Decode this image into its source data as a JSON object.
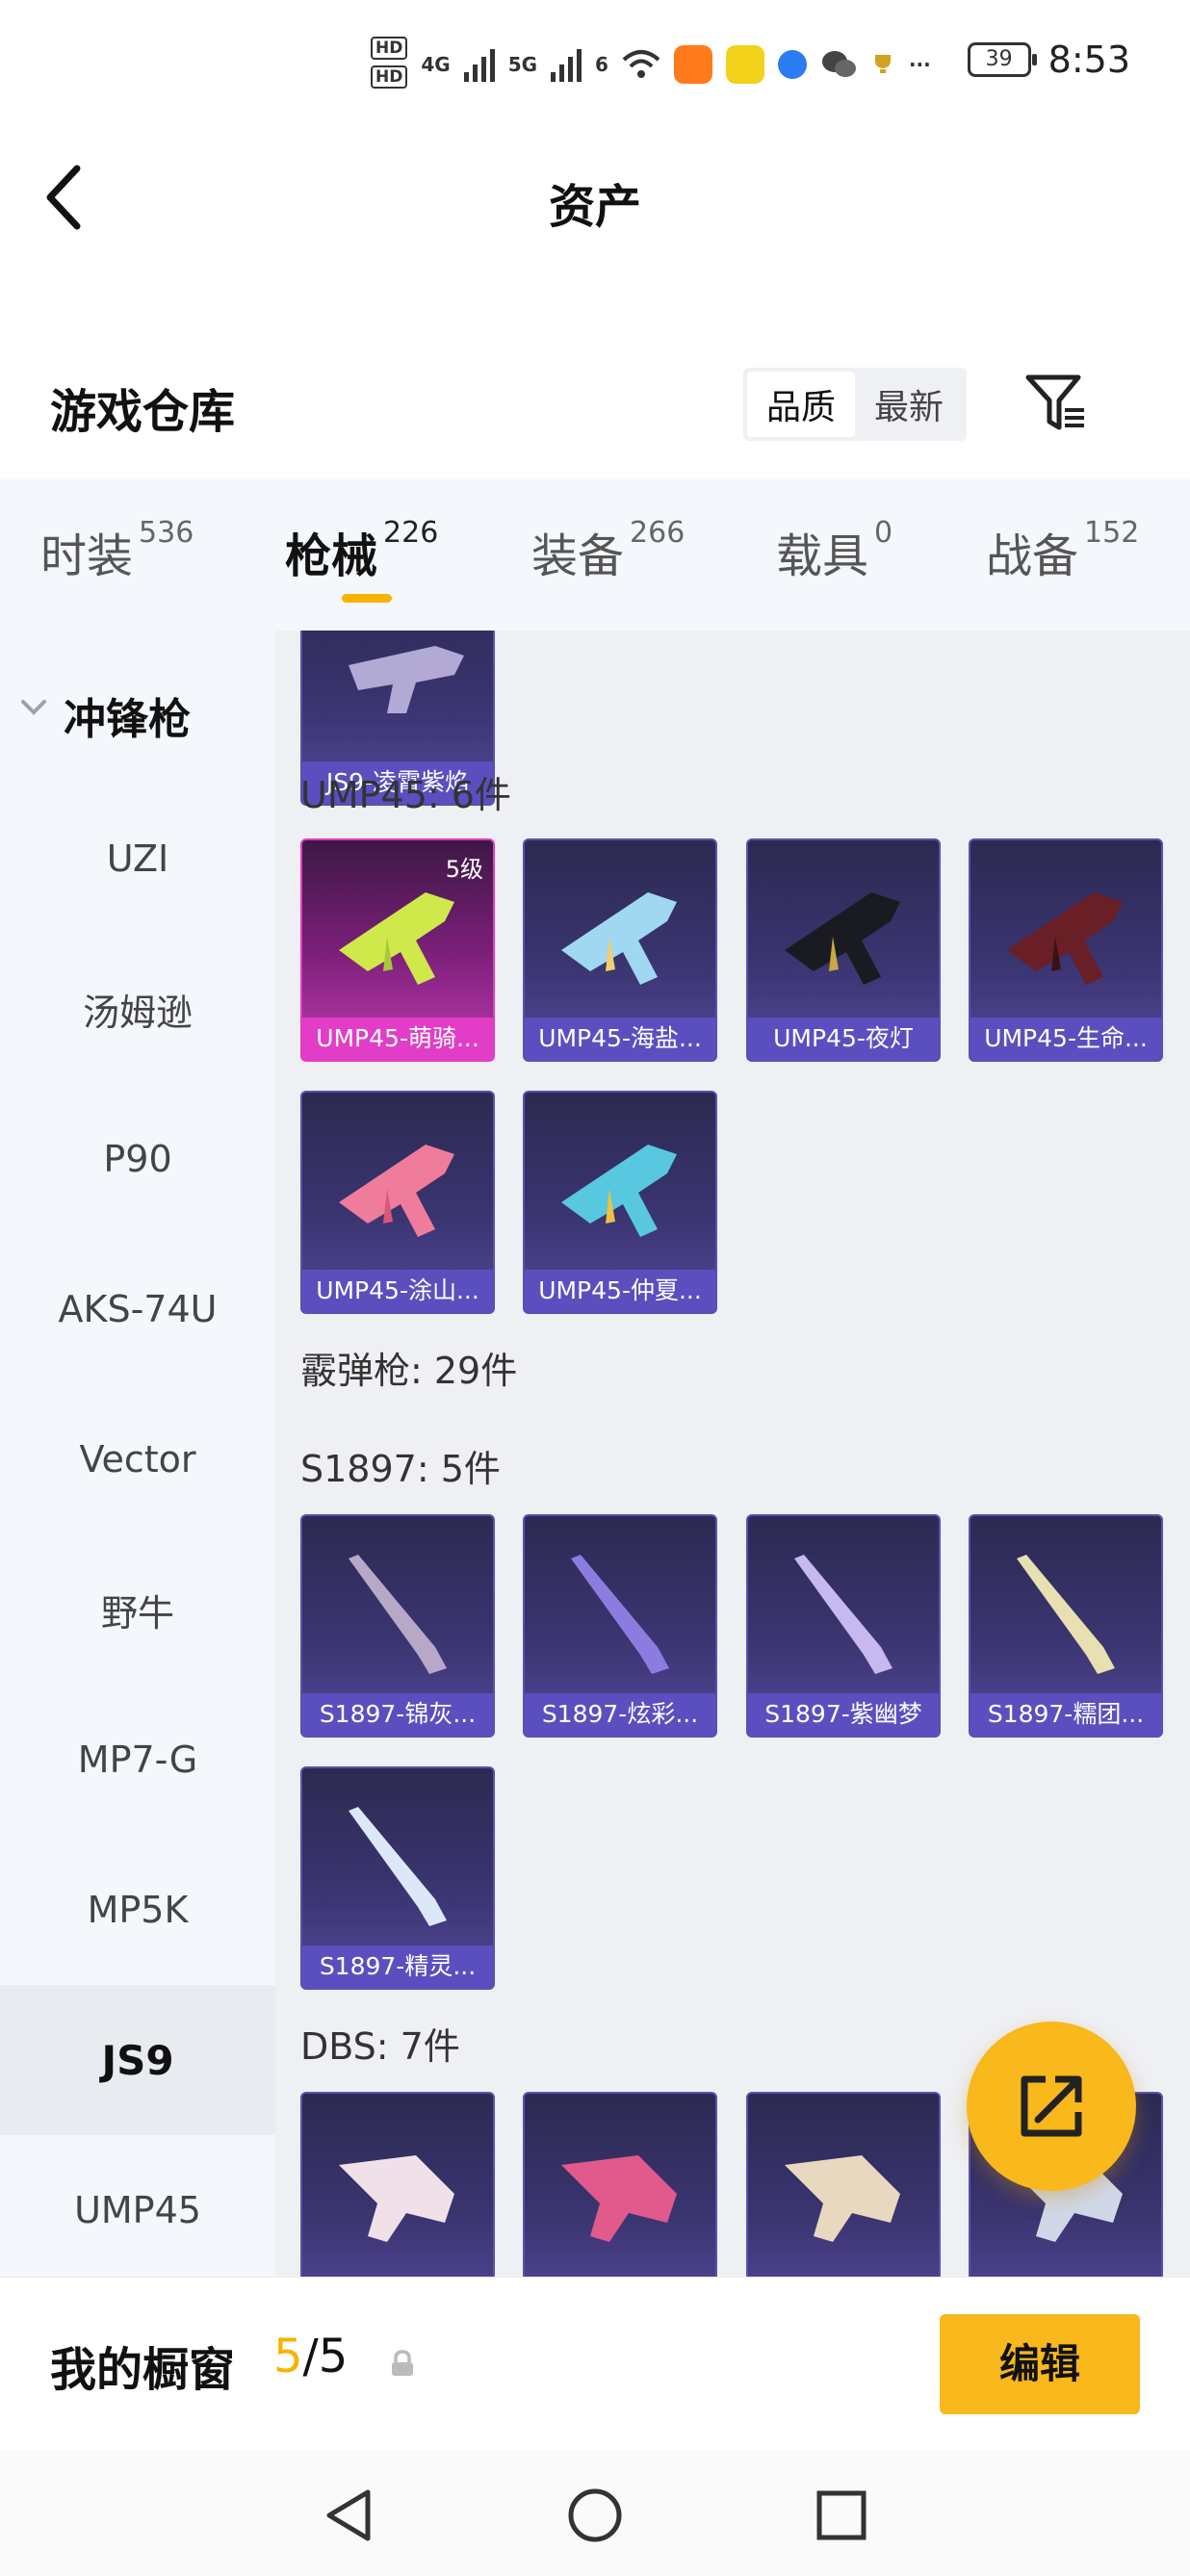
{
  "status_bar": {
    "hd1": "HD",
    "hd2": "HD",
    "net1": "4G",
    "net2": "5G",
    "wifi": "6",
    "battery": "39",
    "time": "8:53",
    "more": "···"
  },
  "header": {
    "title": "资产"
  },
  "section": {
    "title": "游戏仓库",
    "sort_options": [
      "品质",
      "最新"
    ],
    "sort_selected": "品质"
  },
  "tabs": [
    {
      "label": "时装",
      "count": "536"
    },
    {
      "label": "枪械",
      "count": "226"
    },
    {
      "label": "装备",
      "count": "266"
    },
    {
      "label": "载具",
      "count": "0"
    },
    {
      "label": "战备",
      "count": "152"
    }
  ],
  "active_tab": "枪械",
  "sidebar": {
    "group_label": "冲锋枪",
    "items": [
      "UZI",
      "汤姆逊",
      "P90",
      "AKS-74U",
      "Vector",
      "野牛",
      "MP7-G",
      "MP5K",
      "JS9",
      "UMP45"
    ],
    "active": "JS9"
  },
  "content": {
    "partial_top_card": "JS9-凌霄紫焰",
    "groups": [
      {
        "label": "UMP45: 6件",
        "cards": [
          {
            "name": "UMP45-萌骑...",
            "tier": "5级"
          },
          {
            "name": "UMP45-海盐..."
          },
          {
            "name": "UMP45-夜灯"
          },
          {
            "name": "UMP45-生命..."
          },
          {
            "name": "UMP45-涂山..."
          },
          {
            "name": "UMP45-仲夏..."
          }
        ]
      },
      {
        "label": "霰弹枪: 29件"
      },
      {
        "label": "S1897: 5件",
        "cards": [
          {
            "name": "S1897-锦灰..."
          },
          {
            "name": "S1897-炫彩..."
          },
          {
            "name": "S1897-紫幽梦"
          },
          {
            "name": "S1897-糯团..."
          },
          {
            "name": "S1897-精灵..."
          }
        ]
      },
      {
        "label": "DBS: 7件"
      }
    ]
  },
  "bottom_bar": {
    "label": "我的橱窗",
    "count_current": "5",
    "count_total": "/5",
    "edit_label": "编辑"
  },
  "colors": {
    "accent": "#f9b81b",
    "card_purple": "#5b4fc0",
    "card_pink": "#e23dc6",
    "sidebar_bg": "#f4f7fb",
    "content_bg": "#eef0f4"
  },
  "icons": [
    "back-arrow-icon",
    "filter-icon",
    "share-export-icon",
    "lock-icon",
    "nav-back-icon",
    "nav-home-icon",
    "nav-recents-icon"
  ]
}
